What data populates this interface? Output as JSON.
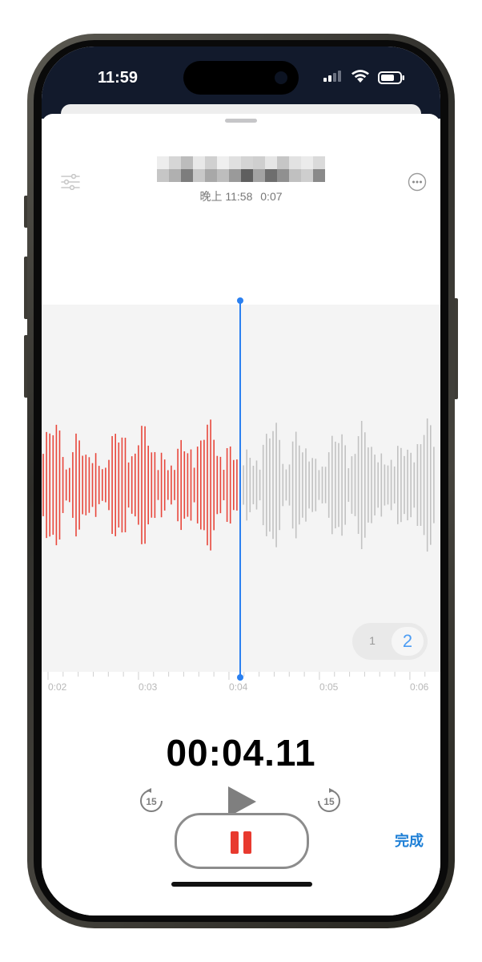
{
  "status_bar": {
    "time": "11:59"
  },
  "recording": {
    "title_redacted": true,
    "time_of_day": "晚上 11:58",
    "duration": "0:07"
  },
  "waveform": {
    "played_color": "#e8463b",
    "unplayed_color": "#c2c2c2",
    "playhead_color": "#2b80f0",
    "ticks": [
      "0:02",
      "0:03",
      "0:04",
      "0:05",
      "0:06"
    ]
  },
  "speed_toggle": {
    "option_1": "1",
    "option_2": "2",
    "selected": "2"
  },
  "playback": {
    "elapsed": "00:04.11"
  },
  "controls": {
    "skip_back": "15",
    "skip_forward": "15",
    "done_label": "完成"
  },
  "icons": [
    "filter-icon",
    "more-icon",
    "skip-back-15-icon",
    "play-icon",
    "skip-forward-15-icon",
    "pause-icon"
  ]
}
